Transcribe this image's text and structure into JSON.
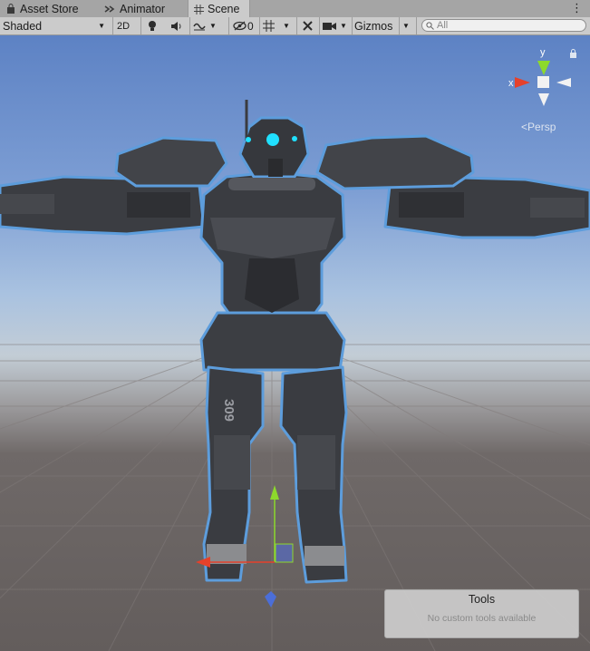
{
  "tabs": [
    {
      "label": "Asset Store",
      "icon": "shopping-bag-icon"
    },
    {
      "label": "Animator",
      "icon": "animator-icon"
    },
    {
      "label": "Scene",
      "icon": "grid-icon",
      "active": true
    }
  ],
  "toolbar": {
    "draw_mode": "Shaded",
    "mode_2d": "2D",
    "hidden_count": "0",
    "gizmos": "Gizmos",
    "search_placeholder": "All"
  },
  "viewport": {
    "projection": "Persp",
    "gizmo_axes": {
      "x": "x",
      "y": "y"
    },
    "chest_number": "309",
    "colors": {
      "x_axis": "#e5412b",
      "y_axis": "#8dd92c",
      "z_axis": "#4b6ed8",
      "eye_glow": "#20e0ff",
      "selection_outline": "#5d9ddc"
    }
  },
  "tools_panel": {
    "title": "Tools",
    "subtitle": "No custom tools available"
  }
}
